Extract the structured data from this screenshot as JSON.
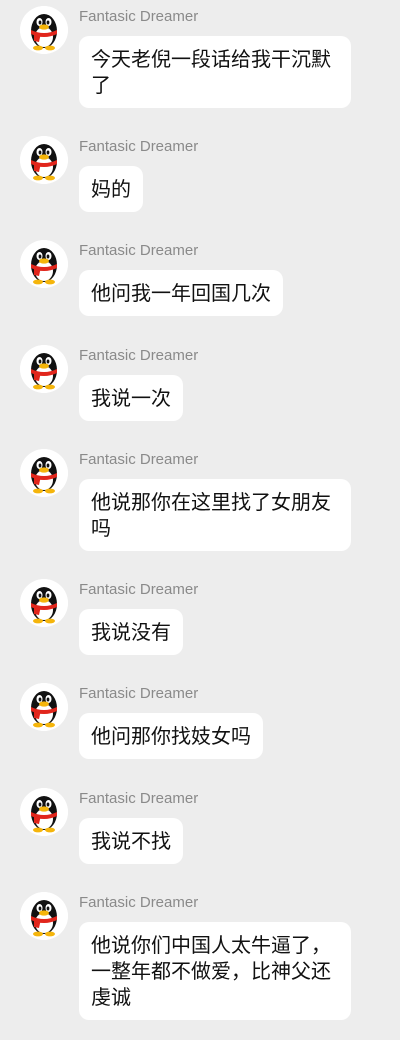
{
  "colors": {
    "background": "#ededed",
    "bubble": "#ffffff",
    "sender_text": "#8a8a8a",
    "message_text": "#111111"
  },
  "messages": [
    {
      "sender": "Fantasic Dreamer",
      "avatar_icon": "qq-penguin-icon",
      "text": "今天老倪一段话给我干沉默了"
    },
    {
      "sender": "Fantasic Dreamer",
      "avatar_icon": "qq-penguin-icon",
      "text": "妈的"
    },
    {
      "sender": "Fantasic Dreamer",
      "avatar_icon": "qq-penguin-icon",
      "text": "他问我一年回国几次"
    },
    {
      "sender": "Fantasic Dreamer",
      "avatar_icon": "qq-penguin-icon",
      "text": "我说一次"
    },
    {
      "sender": "Fantasic Dreamer",
      "avatar_icon": "qq-penguin-icon",
      "text": "他说那你在这里找了女朋友吗"
    },
    {
      "sender": "Fantasic Dreamer",
      "avatar_icon": "qq-penguin-icon",
      "text": "我说没有"
    },
    {
      "sender": "Fantasic Dreamer",
      "avatar_icon": "qq-penguin-icon",
      "text": "他问那你找妓女吗"
    },
    {
      "sender": "Fantasic Dreamer",
      "avatar_icon": "qq-penguin-icon",
      "text": "我说不找"
    },
    {
      "sender": "Fantasic Dreamer",
      "avatar_icon": "qq-penguin-icon",
      "text": "他说你们中国人太牛逼了，一整年都不做爱，比神父还虔诚"
    }
  ]
}
